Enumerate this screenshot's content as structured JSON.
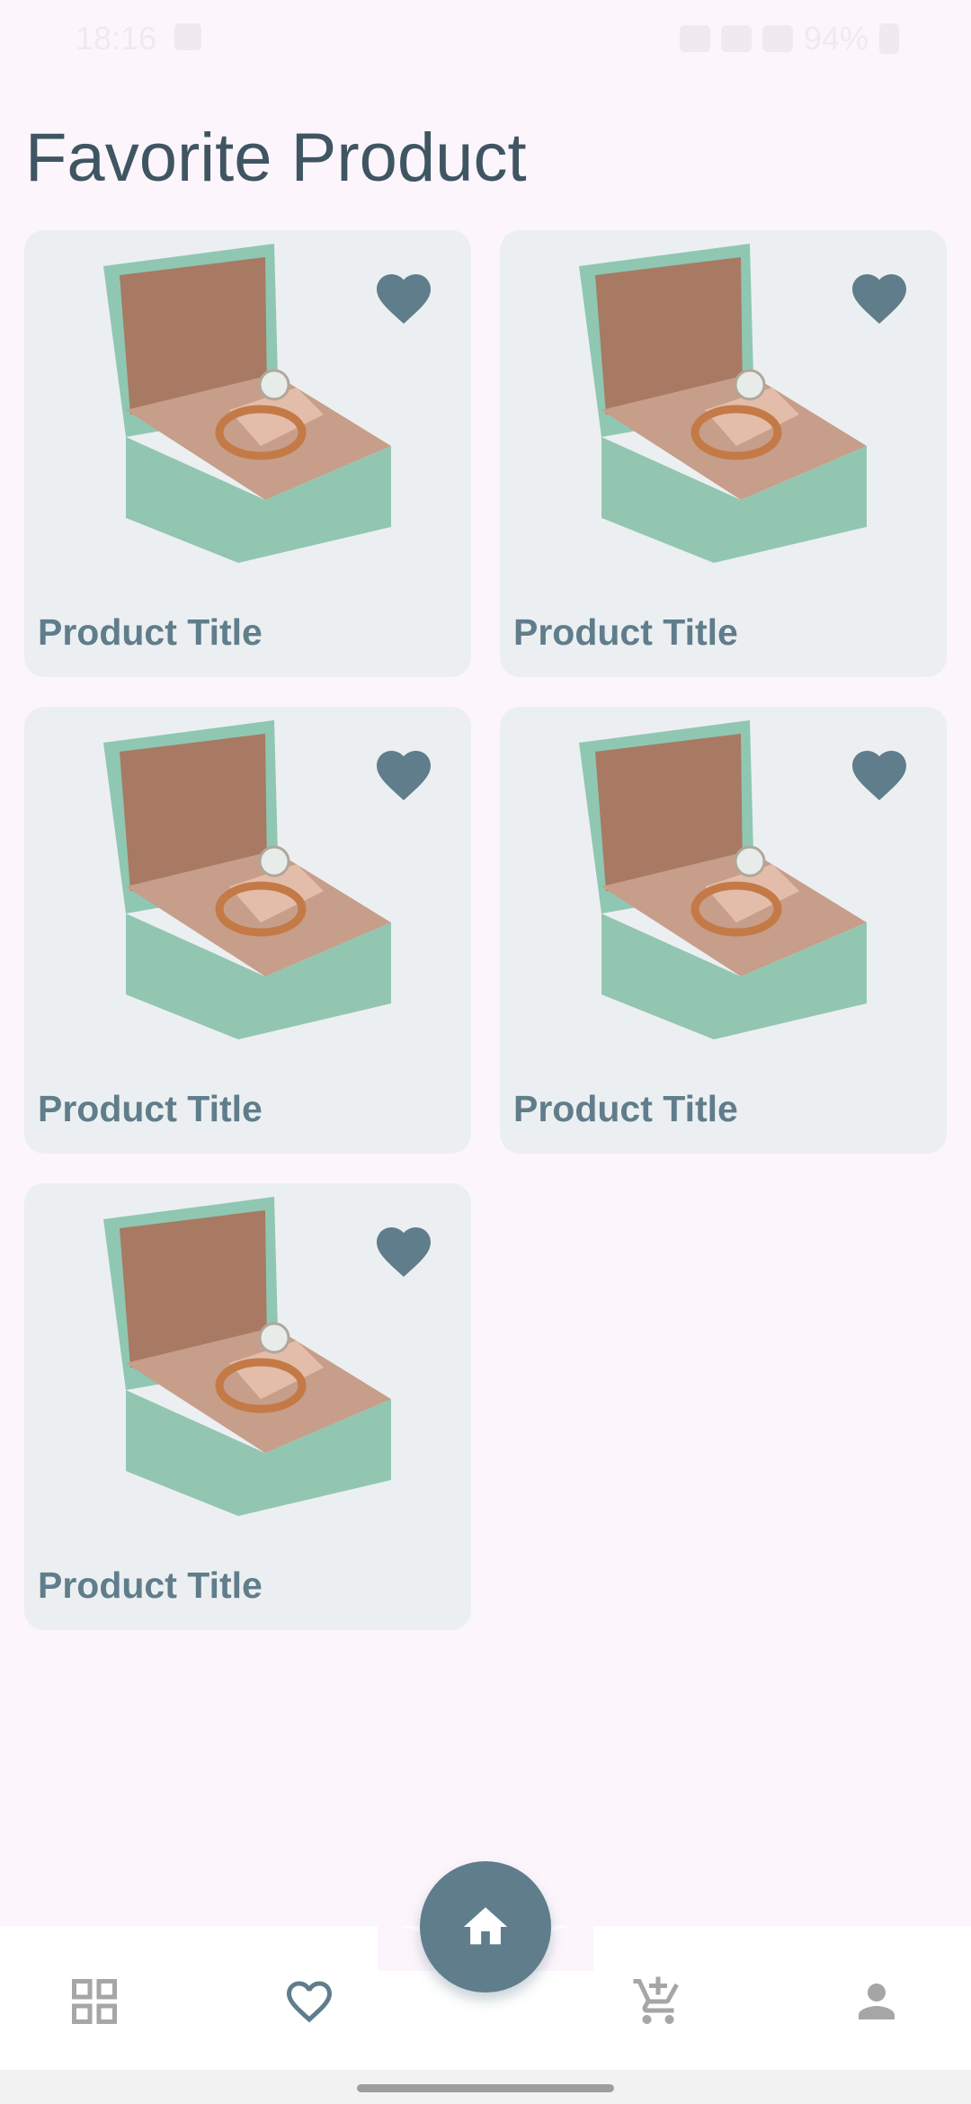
{
  "status_bar": {
    "time": "18:16",
    "battery": "94%"
  },
  "page": {
    "title": "Favorite Product"
  },
  "products": [
    {
      "title": "Product Title",
      "favorited": true
    },
    {
      "title": "Product Title",
      "favorited": true
    },
    {
      "title": "Product Title",
      "favorited": true
    },
    {
      "title": "Product Title",
      "favorited": true
    },
    {
      "title": "Product Title",
      "favorited": true
    }
  ],
  "bottom_nav": {
    "items": [
      {
        "icon": "grid-icon"
      },
      {
        "icon": "heart-outline-icon",
        "selected": true
      },
      {
        "icon": "home-icon",
        "selected": false
      },
      {
        "icon": "cart-add-icon"
      },
      {
        "icon": "person-icon"
      }
    ]
  },
  "colors": {
    "accent": "#607d8b",
    "background": "#fdf5fc",
    "card": "#eceff1",
    "title": "#3f5662",
    "nav_icon_inactive": "#a6a6a6"
  }
}
